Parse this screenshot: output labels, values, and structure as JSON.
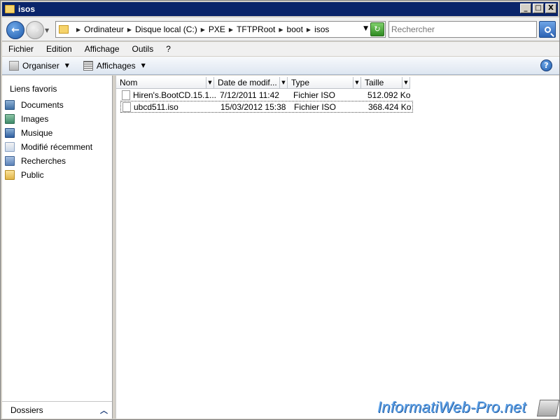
{
  "window": {
    "title": "isos",
    "controls": {
      "minimize": "_",
      "maximize": "□",
      "close": "X"
    }
  },
  "addressbar": {
    "breadcrumbs": [
      "Ordinateur",
      "Disque local (C:)",
      "PXE",
      "TFTPRoot",
      "boot",
      "isos"
    ],
    "search_placeholder": "Rechercher"
  },
  "menubar": {
    "items": [
      "Fichier",
      "Edition",
      "Affichage",
      "Outils",
      "?"
    ]
  },
  "toolbar": {
    "organize_label": "Organiser",
    "views_label": "Affichages",
    "help_label": "?"
  },
  "navpane": {
    "favorites_title": "Liens favoris",
    "items": [
      "Documents",
      "Images",
      "Musique",
      "Modifié récemment",
      "Recherches",
      "Public"
    ],
    "folders_label": "Dossiers"
  },
  "filelist": {
    "columns": [
      "Nom",
      "Date de modif...",
      "Type",
      "Taille"
    ],
    "rows": [
      {
        "name": "Hiren's.BootCD.15.1...",
        "date": "7/12/2011 11:42",
        "type": "Fichier ISO",
        "size": "512.092 Ko"
      },
      {
        "name": "ubcd511.iso",
        "date": "15/03/2012 15:38",
        "type": "Fichier ISO",
        "size": "368.424 Ko"
      }
    ]
  },
  "watermark": {
    "text": "InformatiWeb-Pro.net"
  },
  "colors": {
    "title_bar": "#0a246a",
    "accent_blue": "#1d5aab",
    "watermark": "#5aa0e8"
  }
}
